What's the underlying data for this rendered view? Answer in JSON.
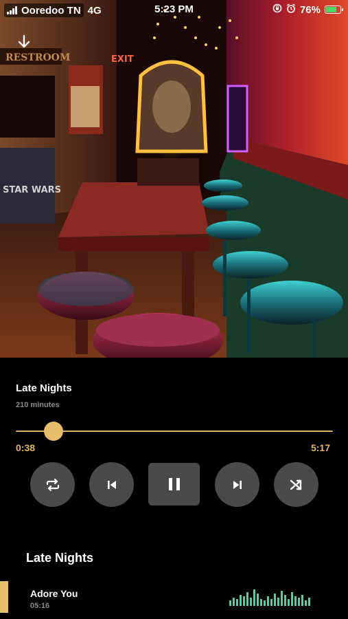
{
  "status_bar": {
    "carrier": "Ooredoo TN",
    "network": "4G",
    "time": "5:23 PM",
    "battery_text": "76%",
    "battery_level": 0.76,
    "icons": [
      "signal-icon",
      "screen-rotation-lock-icon",
      "alarm-icon",
      "battery-charging-icon"
    ]
  },
  "header": {
    "download_icon": "arrow-down-icon"
  },
  "hero": {
    "sign_text": "RESTROOM",
    "exit_text": "EXIT",
    "machine_text": "STAR WARS"
  },
  "player": {
    "title": "Late Nights",
    "duration": "210 minutes",
    "elapsed": "0:38",
    "total": "5:17",
    "progress": 0.12,
    "accent_color": "#e5bc6b",
    "controls": [
      {
        "name": "repeat-button",
        "icon": "repeat-icon"
      },
      {
        "name": "previous-button",
        "icon": "skip-back-icon"
      },
      {
        "name": "pause-button",
        "icon": "pause-icon"
      },
      {
        "name": "next-button",
        "icon": "skip-forward-icon"
      },
      {
        "name": "shuffle-button",
        "icon": "shuffle-icon"
      }
    ]
  },
  "playlist": {
    "title": "Late Nights",
    "now_playing": {
      "song": "Adore You",
      "time": "05:16",
      "equalizer_icon": "equalizer-icon",
      "equalizer_color": "#5fc9a8"
    }
  }
}
